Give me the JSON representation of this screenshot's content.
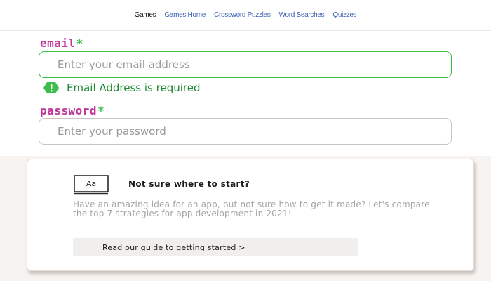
{
  "nav": {
    "items": [
      {
        "label": "Games",
        "active": true
      },
      {
        "label": "Games Home",
        "active": false
      },
      {
        "label": "Crossword Puzzles",
        "active": false
      },
      {
        "label": "Word Searches",
        "active": false
      },
      {
        "label": "Quizzes",
        "active": false
      }
    ]
  },
  "form": {
    "email": {
      "label": "email",
      "required_mark": "*",
      "placeholder": "Enter your email address",
      "value": "",
      "error_icon": "alert-hexagon-icon",
      "error_message": "Email Address is required"
    },
    "password": {
      "label": "password",
      "required_mark": "*",
      "placeholder": "Enter your password",
      "value": ""
    }
  },
  "card": {
    "icon": "font-book-icon",
    "icon_text": "Aa",
    "title": "Not sure where to start?",
    "body": "Have an amazing idea for an app, but not sure how to get it made? Let's compare the top 7 strategies for app development in 2021!",
    "button_label": "Read our guide to getting started >"
  },
  "colors": {
    "label_accent": "#c0369a",
    "required_mark": "#3fbf5a",
    "error_green": "#1d8a34",
    "nav_link": "#3a5fb0"
  }
}
